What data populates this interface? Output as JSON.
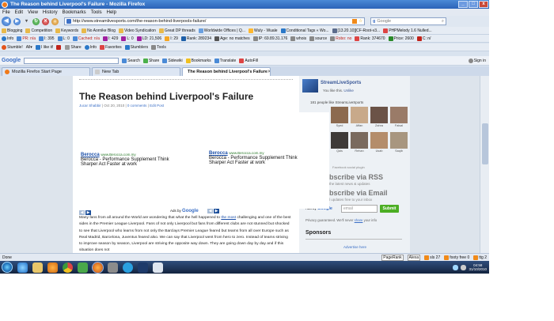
{
  "window": {
    "title": "The Reason behind Liverpool's Failure - Mozilla Firefox",
    "buttons": [
      "_",
      "□",
      "x"
    ]
  },
  "menu": [
    "File",
    "Edit",
    "View",
    "History",
    "Bookmarks",
    "Tools",
    "Help"
  ],
  "nav": {
    "url": "http://www.streamlivesports.com/the-reason-behind-liverpools-failure/",
    "search_placeholder": "Google"
  },
  "toolbar1": [
    "Blogging",
    "Competition",
    "Keywords",
    "No Aornike Blog",
    "Video Syndication",
    "Great DP threads",
    "Worldwide Offices | Q...",
    "Wuly - Wuale",
    "Conditional Tags « Wo...",
    "[13.20.10][CF-Root-v3...",
    "PHPMelody 1.6 Nulled..."
  ],
  "toolbar2": [
    "Info",
    "PR: n/a",
    "I: 395",
    "L: 0",
    "Cached: n/a",
    "I: 429",
    "L: 0",
    "LD: 21,506",
    "I: 29",
    "Rank: 289234",
    "Age: no matches",
    "IP: 69.89.31.176",
    "whois",
    "source",
    "Robo: no",
    "Rank: 374670",
    "Price: 2600",
    "C: n/"
  ],
  "toolbar3": [
    "Stumble!",
    "All",
    "I like it!",
    "Share",
    "Info",
    "Favorites",
    "Stumblers",
    "Tools"
  ],
  "googlebar": {
    "logo": "Google",
    "items": [
      "Search",
      "Share",
      "Sidewiki",
      "Bookmarks",
      "Translate",
      "AutoFill",
      "Sign in"
    ]
  },
  "tabs": [
    {
      "label": "Mozilla Firefox Start Page",
      "active": false
    },
    {
      "label": "New Tab",
      "active": false
    },
    {
      "label": "The Reason behind Liverpool's Failure",
      "active": true
    }
  ],
  "article": {
    "title": "The Reason behind Liverpool's Failure",
    "author": "Jucar Shabbir",
    "date": " | Oct 20, 2010 | ",
    "comments": "0 comments",
    "edit": "Edit Post",
    "ads": [
      {
        "title": "Berocca",
        "url": "www.Berocca.com.my",
        "text": "Berocca - Performance Supplement Think Sharper Act Faster at work"
      },
      {
        "title": "Berocca",
        "url": "www.Berocca.com.my",
        "text": "Berocca - Performance Supplement Think Sharper Act Faster at work"
      }
    ],
    "ads_by": "Ads by",
    "ads_google": "Google",
    "body_pre": "Many fans from all around the World are wondering that what the hell happened to ",
    "body_link": "the most",
    "body_post": " challenging and one of the best sides in the Premier League Liverpool. Fans of not only Liverpool but fans from different clubs are not stunned but shocked to see that Liverpool who learns from not only the Barclays Premier League feared but teams from all over Europe such as Real Madrid, Barcelona, Juventus feared also. We can say that Liverpool went from hero to zero. Instead of teams striving to improve season by season, Liverpool are striving the opposite way down. They are going down day by day and if this situation does not"
  },
  "sidebar": {
    "fb_name": "StreamLiveSports",
    "fb_like": "You like this.",
    "fb_unlike": "Unlike",
    "fb_count": "181 people like StreamLiveSports",
    "faces": [
      "Syed",
      "Affan",
      "Zahra",
      "Faisal",
      "Qais",
      "Rehan",
      "Usab",
      "Saqib"
    ],
    "fb_plugin": "Facebook social plugin",
    "rss_title": "bscribe via RSS",
    "rss_sub1": "the latest news & updates",
    "rss_sub2": "",
    "email_title": "bscribe via Email",
    "email_sub": "l updates free to your inbox",
    "email_placeholder": "email",
    "submit": "Submit",
    "privacy_pre": "Privacy guaranteed. We'll never ",
    "privacy_link": "share",
    "privacy_post": " your info",
    "sponsors": "Sponsors",
    "advertise": "Advertise here"
  },
  "status": {
    "left": "Done",
    "pagerank": "PageRank",
    "alexa": "Alexa",
    "sls": "sls",
    "sls_count": "27",
    "footy": "footy free",
    "footy_count": "0",
    "ttg": "ttg",
    "ttg_count": "2"
  },
  "taskbar": {
    "time": "04:58",
    "date": "31/10/2010"
  }
}
